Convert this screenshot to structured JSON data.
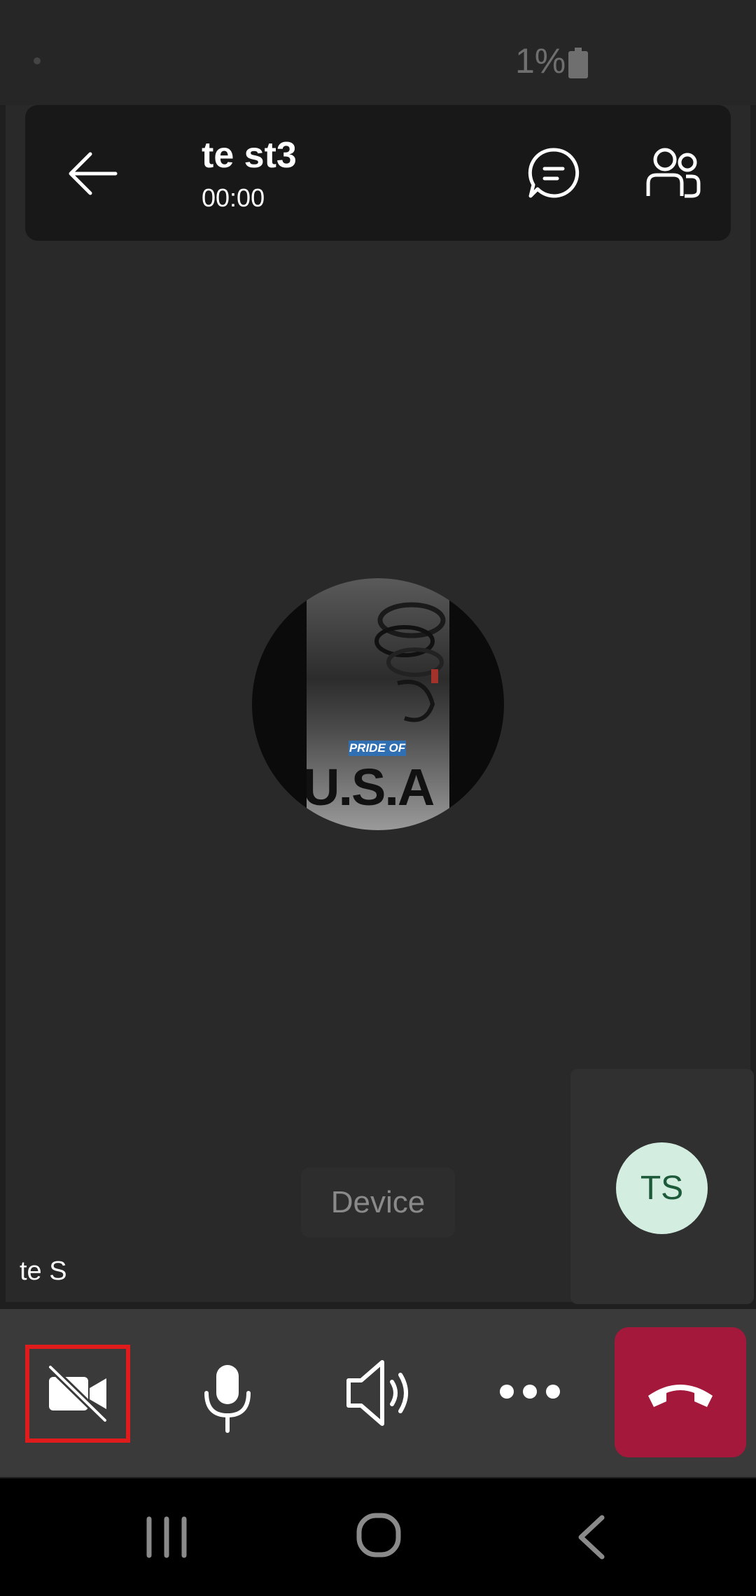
{
  "status_bar": {
    "battery_text": "1%",
    "battery_icon": "battery-icon"
  },
  "header": {
    "title": "te st3",
    "timer": "00:00",
    "back_icon": "arrow-left-icon",
    "chat_icon": "chat-icon",
    "participants_icon": "people-icon"
  },
  "stage": {
    "avatar_photo_text_tag": "PRIDE OF",
    "avatar_photo_text_main": "U.S.A",
    "device_label": "Device",
    "participant_name": "te S"
  },
  "self_view": {
    "initials": "TS"
  },
  "controls": {
    "video_icon": "video-off-icon",
    "mic_icon": "microphone-icon",
    "speaker_icon": "speaker-icon",
    "more_icon": "more-icon",
    "end_call_icon": "hang-up-icon",
    "end_call_color": "#a4183b",
    "highlight_color": "#e01b1b"
  },
  "nav_bar": {
    "recent_icon": "recent-apps-icon",
    "home_icon": "home-icon",
    "back_icon": "back-icon"
  }
}
